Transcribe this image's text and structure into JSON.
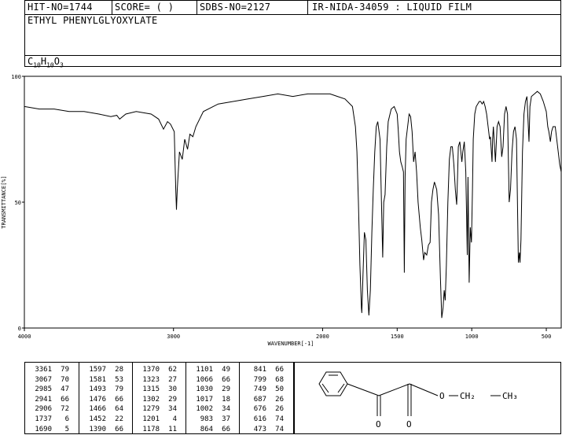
{
  "header": {
    "hit_no": "HIT-NO=1744",
    "score": "SCORE=  (   )",
    "sdbs_no": "SDBS-NO=2127",
    "ir_info": "IR-NIDA-34059 : LIQUID FILM",
    "compound_name": "ETHYL PHENYLGLYOXYLATE",
    "formula_parts": [
      "C",
      "10",
      "H",
      "10",
      "O",
      "3"
    ]
  },
  "chart_data": {
    "type": "line",
    "xlabel": "WAVENUMBER[-1]",
    "ylabel": "TRANSMITTANCE[%]",
    "xlim": [
      4000,
      400
    ],
    "ylim": [
      0,
      100
    ],
    "x_ticks": [
      {
        "value": 4000,
        "label": "4000"
      },
      {
        "value": 3000,
        "label": "3000"
      },
      {
        "value": 2000,
        "label": "2000"
      },
      {
        "value": 1500,
        "label": "1500"
      },
      {
        "value": 1000,
        "label": "1000"
      },
      {
        "value": 500,
        "label": "500"
      }
    ],
    "y_ticks": [
      {
        "value": 0,
        "label": "0"
      },
      {
        "value": 50,
        "label": "50"
      },
      {
        "value": 100,
        "label": "100"
      }
    ],
    "series": [
      {
        "points": [
          [
            4000,
            88
          ],
          [
            3900,
            87
          ],
          [
            3800,
            87
          ],
          [
            3700,
            86
          ],
          [
            3600,
            86
          ],
          [
            3500,
            85
          ],
          [
            3420,
            84
          ],
          [
            3380,
            84.5
          ],
          [
            3361,
            83
          ],
          [
            3320,
            85
          ],
          [
            3250,
            86
          ],
          [
            3150,
            85
          ],
          [
            3100,
            83
          ],
          [
            3067,
            79
          ],
          [
            3040,
            82
          ],
          [
            3020,
            81
          ],
          [
            2995,
            78
          ],
          [
            2985,
            55
          ],
          [
            2980,
            47
          ],
          [
            2975,
            55
          ],
          [
            2960,
            70
          ],
          [
            2941,
            67
          ],
          [
            2925,
            75
          ],
          [
            2906,
            71
          ],
          [
            2890,
            77
          ],
          [
            2870,
            76
          ],
          [
            2850,
            80
          ],
          [
            2800,
            86
          ],
          [
            2700,
            89
          ],
          [
            2600,
            90
          ],
          [
            2500,
            91
          ],
          [
            2400,
            92
          ],
          [
            2300,
            93
          ],
          [
            2200,
            92
          ],
          [
            2100,
            93
          ],
          [
            2000,
            93
          ],
          [
            1950,
            93
          ],
          [
            1900,
            92
          ],
          [
            1850,
            91
          ],
          [
            1800,
            88
          ],
          [
            1780,
            80
          ],
          [
            1770,
            70
          ],
          [
            1760,
            50
          ],
          [
            1750,
            25
          ],
          [
            1740,
            8
          ],
          [
            1737,
            6
          ],
          [
            1730,
            20
          ],
          [
            1720,
            38
          ],
          [
            1710,
            35
          ],
          [
            1700,
            15
          ],
          [
            1690,
            5
          ],
          [
            1680,
            15
          ],
          [
            1670,
            38
          ],
          [
            1660,
            55
          ],
          [
            1650,
            70
          ],
          [
            1640,
            80
          ],
          [
            1630,
            82
          ],
          [
            1615,
            75
          ],
          [
            1597,
            28
          ],
          [
            1590,
            50
          ],
          [
            1581,
            53
          ],
          [
            1570,
            72
          ],
          [
            1560,
            82
          ],
          [
            1540,
            87
          ],
          [
            1520,
            88
          ],
          [
            1500,
            85
          ],
          [
            1493,
            79
          ],
          [
            1485,
            70
          ],
          [
            1476,
            66
          ],
          [
            1466,
            64
          ],
          [
            1458,
            62
          ],
          [
            1452,
            22
          ],
          [
            1447,
            60
          ],
          [
            1440,
            75
          ],
          [
            1420,
            85
          ],
          [
            1410,
            84
          ],
          [
            1400,
            78
          ],
          [
            1390,
            66
          ],
          [
            1380,
            70
          ],
          [
            1370,
            62
          ],
          [
            1360,
            50
          ],
          [
            1345,
            40
          ],
          [
            1335,
            35
          ],
          [
            1323,
            27
          ],
          [
            1315,
            30
          ],
          [
            1302,
            29
          ],
          [
            1290,
            33
          ],
          [
            1279,
            34
          ],
          [
            1270,
            50
          ],
          [
            1260,
            55
          ],
          [
            1250,
            58
          ],
          [
            1235,
            55
          ],
          [
            1222,
            45
          ],
          [
            1210,
            20
          ],
          [
            1201,
            4
          ],
          [
            1192,
            8
          ],
          [
            1185,
            15
          ],
          [
            1178,
            11
          ],
          [
            1170,
            25
          ],
          [
            1160,
            50
          ],
          [
            1150,
            67
          ],
          [
            1140,
            72
          ],
          [
            1130,
            72
          ],
          [
            1120,
            65
          ],
          [
            1110,
            55
          ],
          [
            1101,
            49
          ],
          [
            1095,
            60
          ],
          [
            1090,
            72
          ],
          [
            1080,
            74
          ],
          [
            1066,
            66
          ],
          [
            1060,
            70
          ],
          [
            1050,
            74
          ],
          [
            1040,
            62
          ],
          [
            1030,
            29
          ],
          [
            1025,
            60
          ],
          [
            1017,
            18
          ],
          [
            1010,
            40
          ],
          [
            1002,
            34
          ],
          [
            995,
            55
          ],
          [
            990,
            75
          ],
          [
            980,
            85
          ],
          [
            970,
            88
          ],
          [
            960,
            89
          ],
          [
            950,
            90
          ],
          [
            940,
            90
          ],
          [
            930,
            89
          ],
          [
            920,
            90
          ],
          [
            910,
            88
          ],
          [
            900,
            85
          ],
          [
            890,
            80
          ],
          [
            880,
            75
          ],
          [
            875,
            76
          ],
          [
            864,
            66
          ],
          [
            860,
            75
          ],
          [
            855,
            80
          ],
          [
            841,
            66
          ],
          [
            830,
            80
          ],
          [
            820,
            82
          ],
          [
            810,
            80
          ],
          [
            799,
            68
          ],
          [
            790,
            72
          ],
          [
            780,
            85
          ],
          [
            770,
            88
          ],
          [
            760,
            85
          ],
          [
            749,
            50
          ],
          [
            740,
            55
          ],
          [
            730,
            70
          ],
          [
            720,
            78
          ],
          [
            710,
            80
          ],
          [
            700,
            75
          ],
          [
            687,
            26
          ],
          [
            680,
            30
          ],
          [
            676,
            26
          ],
          [
            670,
            35
          ],
          [
            660,
            70
          ],
          [
            650,
            85
          ],
          [
            640,
            90
          ],
          [
            630,
            92
          ],
          [
            616,
            74
          ],
          [
            610,
            88
          ],
          [
            600,
            92
          ],
          [
            580,
            93
          ],
          [
            560,
            94
          ],
          [
            540,
            93
          ],
          [
            520,
            90
          ],
          [
            500,
            86
          ],
          [
            490,
            80
          ],
          [
            483,
            78
          ],
          [
            473,
            74
          ],
          [
            465,
            78
          ],
          [
            455,
            80
          ],
          [
            440,
            80
          ],
          [
            430,
            75
          ],
          [
            420,
            70
          ],
          [
            410,
            65
          ],
          [
            400,
            62
          ]
        ]
      }
    ]
  },
  "peak_table": {
    "columns": [
      [
        [
          "3361",
          "79"
        ],
        [
          "3067",
          "70"
        ],
        [
          "2985",
          "47"
        ],
        [
          "2941",
          "66"
        ],
        [
          "2906",
          "72"
        ],
        [
          "1737",
          "6"
        ],
        [
          "1690",
          "5"
        ]
      ],
      [
        [
          "1597",
          "28"
        ],
        [
          "1581",
          "53"
        ],
        [
          "1493",
          "79"
        ],
        [
          "1476",
          "66"
        ],
        [
          "1466",
          "64"
        ],
        [
          "1452",
          "22"
        ],
        [
          "1390",
          "66"
        ]
      ],
      [
        [
          "1370",
          "62"
        ],
        [
          "1323",
          "27"
        ],
        [
          "1315",
          "30"
        ],
        [
          "1302",
          "29"
        ],
        [
          "1279",
          "34"
        ],
        [
          "1201",
          "4"
        ],
        [
          "1178",
          "11"
        ]
      ],
      [
        [
          "1101",
          "49"
        ],
        [
          "1066",
          "66"
        ],
        [
          "1030",
          "29"
        ],
        [
          "1017",
          "18"
        ],
        [
          "1002",
          "34"
        ],
        [
          "983",
          "37"
        ],
        [
          "864",
          "66"
        ]
      ],
      [
        [
          "841",
          "66"
        ],
        [
          "799",
          "68"
        ],
        [
          "749",
          "50"
        ],
        [
          "687",
          "26"
        ],
        [
          "676",
          "26"
        ],
        [
          "616",
          "74"
        ],
        [
          "473",
          "74"
        ]
      ]
    ]
  },
  "structure": {
    "carbonyl_oxygen_1": "O",
    "carbonyl_oxygen_2": "O",
    "ester_oxygen": "O",
    "methylene": "CH₂",
    "methyl": "CH₃"
  }
}
